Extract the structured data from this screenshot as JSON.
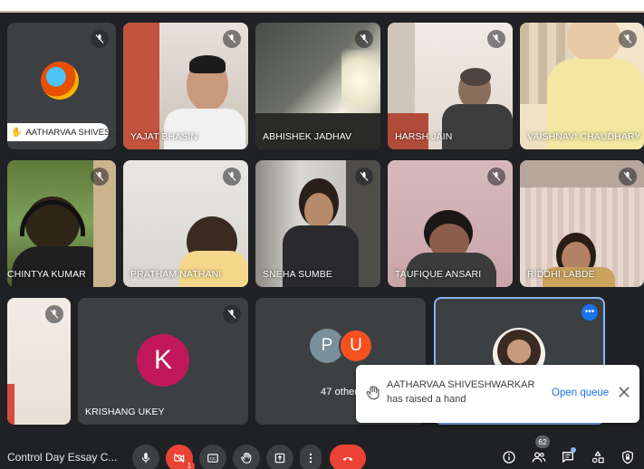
{
  "meeting": {
    "title": "Control Day Essay C...",
    "participants_badge": "62",
    "notification_badge": "1"
  },
  "tiles": [
    {
      "id": "aatharvaa",
      "name": "AATHARVAA SHIVES..."
    },
    {
      "id": "yajat",
      "name": "YAJAT BHASIN"
    },
    {
      "id": "abhishek",
      "name": "ABHISHEK JADHAV"
    },
    {
      "id": "harsh",
      "name": "HARSH JAIN"
    },
    {
      "id": "vaishnavi",
      "name": "VAISHNAVI CHAUDHARY"
    },
    {
      "id": "chintya",
      "name": "CHINTYA KUMAR"
    },
    {
      "id": "pratham",
      "name": "PRATHAM NATHANI"
    },
    {
      "id": "sneha",
      "name": "SNEHA SUMBE"
    },
    {
      "id": "taufique",
      "name": "TAUFIQUE ANSARI"
    },
    {
      "id": "riddhi",
      "name": "RIDDHI LABDE"
    },
    {
      "id": "partial",
      "name": ""
    },
    {
      "id": "krishang",
      "name": "KRISHANG UKEY",
      "initial": "K"
    },
    {
      "id": "others",
      "name": "47 others",
      "initials": [
        "P",
        "U"
      ]
    },
    {
      "id": "presenter",
      "name": ""
    }
  ],
  "toast": {
    "message": "AATHARVAA SHIVESHWARKAR has raised a hand",
    "action": "Open queue"
  },
  "colors": {
    "background": "#202124",
    "tile": "#3c4043",
    "end_call": "#ea4335",
    "cam_off": "#ea4335",
    "krishang_avatar": "#c2185b",
    "avatar_p": "#78909c",
    "avatar_u": "#f4511e",
    "accent": "#1a73e8"
  },
  "icons": {
    "mute": "mic-off-icon",
    "mic": "mic-icon",
    "camera": "camera-off-icon",
    "captions": "captions-icon",
    "raise_hand": "hand-icon",
    "present": "present-icon",
    "more": "more-vert-icon",
    "end_call": "call-end-icon",
    "info": "info-icon",
    "people": "people-icon",
    "chat": "chat-icon",
    "activities": "activities-icon",
    "host": "host-controls-icon",
    "close": "close-icon"
  }
}
